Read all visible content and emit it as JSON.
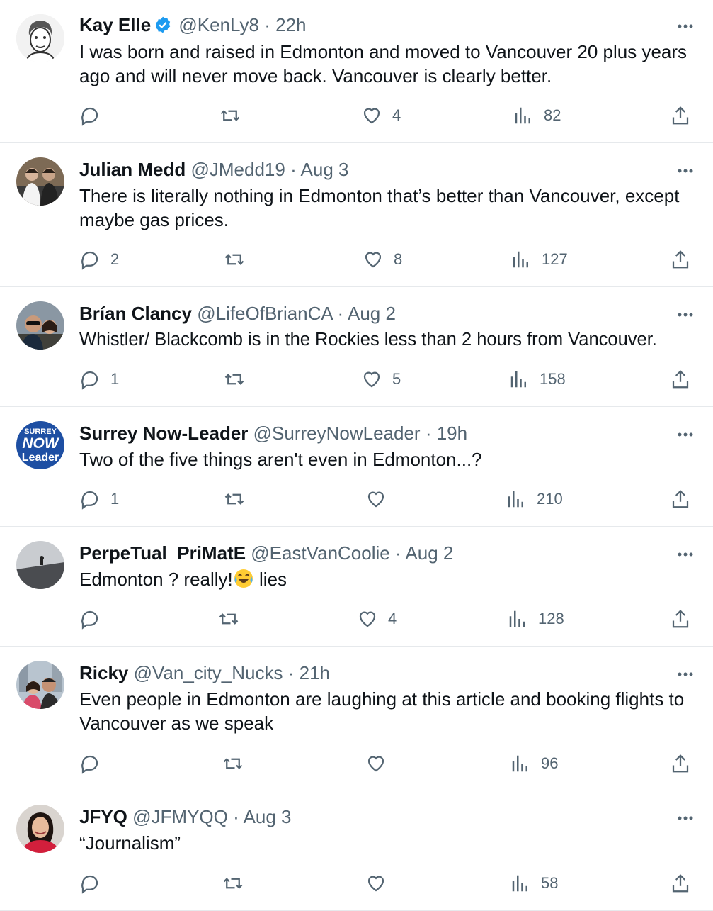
{
  "colors": {
    "text": "#0f1419",
    "muted": "#536471",
    "verified": "#1d9bf0",
    "divider": "#e6e9ec"
  },
  "tweets": [
    {
      "name": "Kay Elle",
      "verified": true,
      "handle": "@KenLy8",
      "time": "22h",
      "text": "I was born and raised in Edmonton and moved to Vancouver 20 plus years ago and will never move back. Vancouver is clearly better.",
      "replies": "",
      "retweets": "",
      "likes": "4",
      "views": "82",
      "avatar": "cartoon-portrait"
    },
    {
      "name": "Julian Medd",
      "verified": false,
      "handle": "@JMedd19",
      "time": "Aug 3",
      "text": "There is literally nothing in Edmonton that’s better than Vancouver, except maybe gas prices.",
      "replies": "2",
      "retweets": "",
      "likes": "8",
      "views": "127",
      "avatar": "two-men-photo"
    },
    {
      "name": "Brían Clancy",
      "verified": false,
      "handle": "@LifeOfBrianCA",
      "time": "Aug 2",
      "text": "Whistler/ Blackcomb is in the Rockies less than 2 hours from Vancouver.",
      "replies": "1",
      "retweets": "",
      "likes": "5",
      "views": "158",
      "avatar": "couple-selfie-photo"
    },
    {
      "name": "Surrey Now-Leader",
      "verified": false,
      "handle": "@SurreyNowLeader",
      "time": "19h",
      "text": "Two of the five things aren't even in Edmonton...?",
      "replies": "1",
      "retweets": "",
      "likes": "",
      "views": "210",
      "avatar": "surrey-now-leader-logo",
      "logo_text": [
        "SURREY",
        "NOW",
        "Leader"
      ]
    },
    {
      "name": "PerpeTual_PriMatE",
      "verified": false,
      "handle": "@EastVanCoolie",
      "time": "Aug 2",
      "text": "Edmonton ? really!",
      "text_after": " lies",
      "emoji": "tears-of-joy-emoji",
      "replies": "",
      "retweets": "",
      "likes": "4",
      "views": "128",
      "avatar": "rooftop-photo"
    },
    {
      "name": "Ricky",
      "verified": false,
      "handle": "@Van_city_Nucks",
      "time": "21h",
      "text": "Even people in Edmonton are laughing at this article and booking flights to Vancouver as we speak",
      "replies": "",
      "retweets": "",
      "likes": "",
      "views": "96",
      "avatar": "couple-city-photo"
    },
    {
      "name": "JFYQ",
      "verified": false,
      "handle": "@JFMYQQ",
      "time": "Aug 3",
      "text": "“Journalism”",
      "replies": "",
      "retweets": "",
      "likes": "",
      "views": "58",
      "avatar": "woman-portrait-photo"
    }
  ]
}
